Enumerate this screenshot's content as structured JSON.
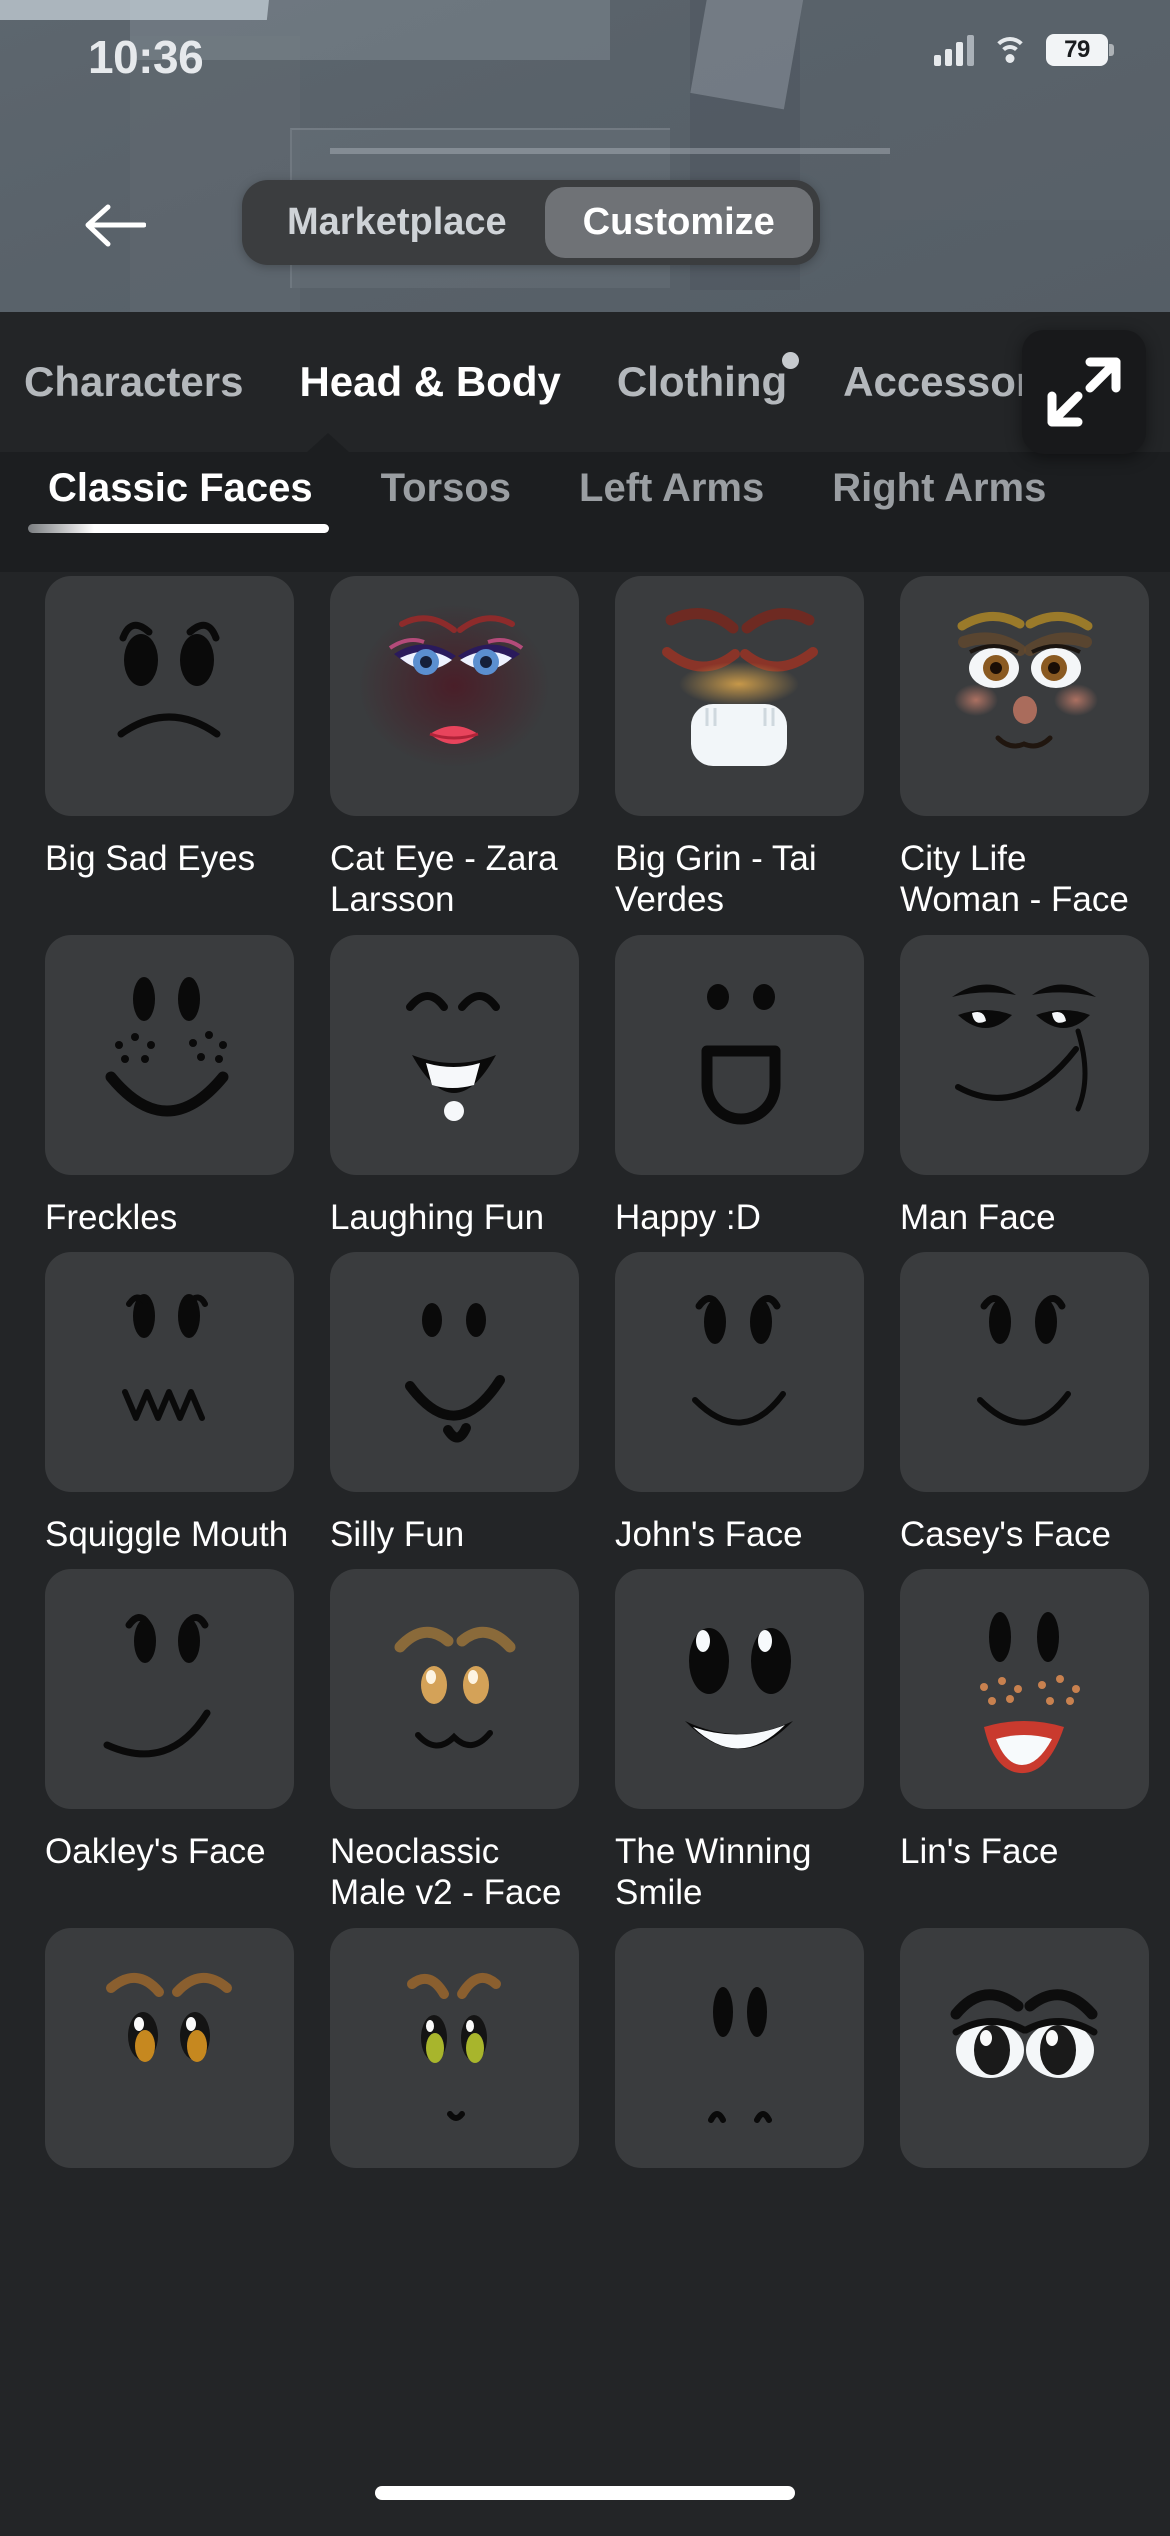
{
  "status_bar": {
    "time": "10:36",
    "battery_level": "79",
    "signal_icon": "cellular-signal-icon",
    "wifi_icon": "wifi-icon",
    "battery_icon": "battery-icon"
  },
  "header": {
    "back_icon": "back-arrow-icon",
    "segments": [
      {
        "label": "Marketplace",
        "active": false
      },
      {
        "label": "Customize",
        "active": true
      }
    ]
  },
  "category_tabs": [
    {
      "label": "Characters",
      "active": false,
      "badge": false
    },
    {
      "label": "Head & Body",
      "active": true,
      "badge": false
    },
    {
      "label": "Clothing",
      "active": false,
      "badge": true
    },
    {
      "label": "Accessories",
      "active": false,
      "badge": false
    }
  ],
  "expand_button": {
    "icon": "expand-diagonal-arrows-icon"
  },
  "sub_tabs": [
    {
      "label": "Classic Faces",
      "active": true
    },
    {
      "label": "Torsos",
      "active": false
    },
    {
      "label": "Left Arms",
      "active": false
    },
    {
      "label": "Right Arms",
      "active": false
    }
  ],
  "grid": {
    "rows": [
      [
        {
          "label": "Big Sad Eyes",
          "face": "big-sad-eyes"
        },
        {
          "label": "Cat Eye - Zara Larsson",
          "face": "cat-eye-zara"
        },
        {
          "label": "Big Grin - Tai Verdes",
          "face": "big-grin-tai"
        },
        {
          "label": "City Life Woman - Face",
          "face": "city-life-woman"
        }
      ],
      [
        {
          "label": "Freckles",
          "face": "freckles"
        },
        {
          "label": "Laughing Fun",
          "face": "laughing-fun"
        },
        {
          "label": "Happy :D",
          "face": "happy-d"
        },
        {
          "label": "Man Face",
          "face": "man-face"
        }
      ],
      [
        {
          "label": "Squiggle Mouth",
          "face": "squiggle-mouth"
        },
        {
          "label": "Silly Fun",
          "face": "silly-fun"
        },
        {
          "label": "John's Face",
          "face": "johns-face"
        },
        {
          "label": "Casey's Face",
          "face": "caseys-face"
        }
      ],
      [
        {
          "label": "Oakley's Face",
          "face": "oakleys-face"
        },
        {
          "label": "Neoclassic Male v2 - Face",
          "face": "neoclassic-male-v2"
        },
        {
          "label": "The Winning Smile",
          "face": "winning-smile"
        },
        {
          "label": "Lin's Face",
          "face": "lins-face"
        }
      ],
      [
        {
          "label": "",
          "face": "brown-eyes-brows"
        },
        {
          "label": "",
          "face": "green-eyes-brows"
        },
        {
          "label": "",
          "face": "simple-dot-eyes"
        },
        {
          "label": "",
          "face": "realistic-eyes"
        }
      ]
    ]
  },
  "colors": {
    "panel_bg": "#232527",
    "tile_bg": "#3a3c3e",
    "subbar_bg": "#1c1e20",
    "accent_text": "#ffffff",
    "muted_text": "#b4b8bc",
    "segment_active_bg": "#6f7276",
    "game_bg": "#5b636b"
  },
  "home_indicator": "home-indicator"
}
